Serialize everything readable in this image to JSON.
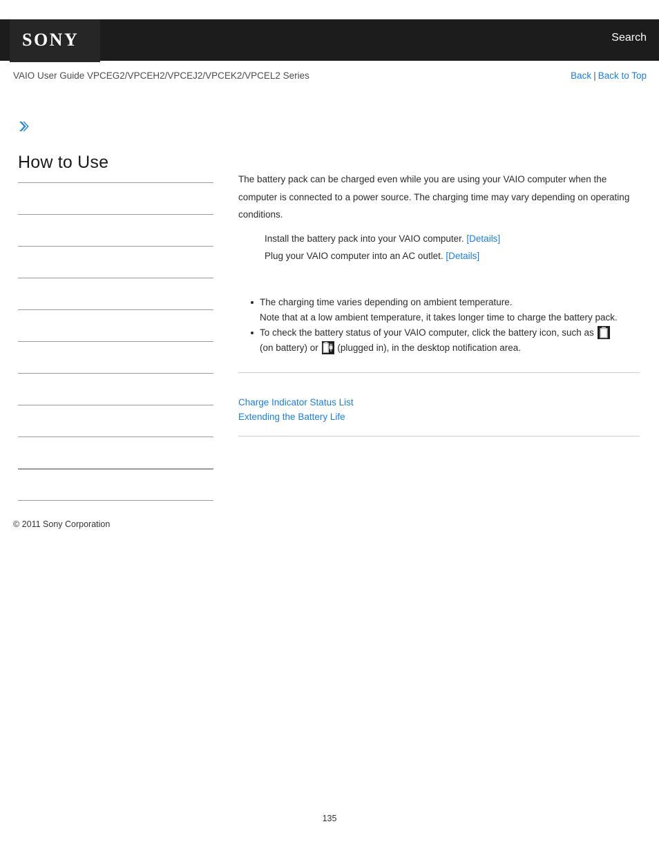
{
  "header": {
    "logo": "SONY",
    "search_label": "Search"
  },
  "subheader": {
    "guide_title": "VAIO User Guide VPCEG2/VPCEH2/VPCEJ2/VPCEK2/VPCEL2 Series",
    "back_label": "Back",
    "separator": "|",
    "back_to_top_label": "Back to Top"
  },
  "sidebar": {
    "heading": "How to Use",
    "items": [
      {
        "label": ""
      },
      {
        "label": ""
      },
      {
        "label": ""
      },
      {
        "label": ""
      },
      {
        "label": ""
      },
      {
        "label": ""
      },
      {
        "label": ""
      },
      {
        "label": ""
      },
      {
        "label": ""
      },
      {
        "label": ""
      },
      {
        "label": ""
      }
    ],
    "copyright": "© 2011 Sony Corporation"
  },
  "content": {
    "intro": "The battery pack can be charged even while you are using your VAIO computer when the computer is connected to a power source. The charging time may vary depending on operating conditions.",
    "steps": [
      {
        "text": "Install the battery pack into your VAIO computer.",
        "link": "[Details]"
      },
      {
        "text": "Plug your VAIO computer into an AC outlet.",
        "link": "[Details]"
      }
    ],
    "notes": [
      {
        "line1": "The charging time varies depending on ambient temperature.",
        "line2": "Note that at a low ambient temperature, it takes longer time to charge the battery pack."
      },
      {
        "part1": "To check the battery status of your VAIO computer, click the battery icon, such as",
        "part2": "(on battery) or",
        "part3": "(plugged in), in the desktop notification area."
      }
    ],
    "related_links": [
      "Charge Indicator Status List",
      "Extending the Battery Life"
    ]
  },
  "footer": {
    "page_number": "135"
  },
  "colors": {
    "link": "#1a7fd4",
    "header_bg": "#1c1c1c",
    "logo_bg": "#262626",
    "rule": "#cccccc",
    "sidebar_rule": "#9a9a9a"
  }
}
